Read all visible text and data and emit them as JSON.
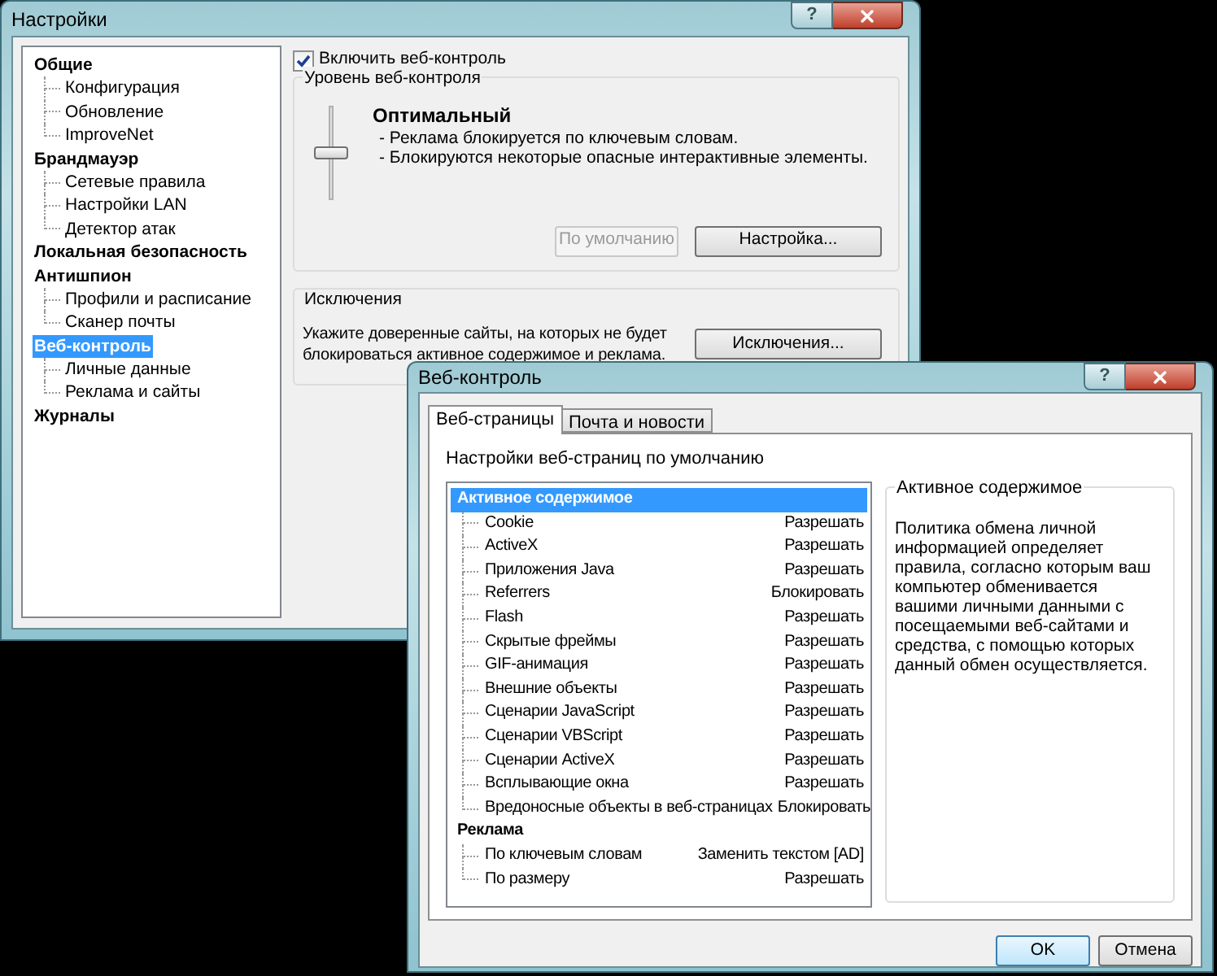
{
  "main_window": {
    "title": "Настройки",
    "help": "?",
    "nav": [
      {
        "label": "Общие",
        "selected": false,
        "children": [
          {
            "label": "Конфигурация",
            "selected": false
          },
          {
            "label": "Обновление",
            "selected": false
          },
          {
            "label": "ImproveNet",
            "selected": false
          }
        ]
      },
      {
        "label": "Брандмауэр",
        "selected": false,
        "children": [
          {
            "label": "Сетевые правила",
            "selected": false
          },
          {
            "label": "Настройки LAN",
            "selected": false
          },
          {
            "label": "Детектор атак",
            "selected": false
          }
        ]
      },
      {
        "label": "Локальная безопасность",
        "selected": false
      },
      {
        "label": "Антишпион",
        "selected": false,
        "children": [
          {
            "label": "Профили и расписание",
            "selected": false
          },
          {
            "label": "Сканер почты",
            "selected": false
          }
        ]
      },
      {
        "label": "Веб-контроль",
        "selected": true,
        "children": [
          {
            "label": "Личные данные",
            "selected": false
          },
          {
            "label": "Реклама и сайты",
            "selected": false
          }
        ]
      },
      {
        "label": "Журналы",
        "selected": false
      }
    ],
    "enable_checkbox": {
      "label": "Включить веб-контроль",
      "checked": true
    },
    "level_group": {
      "title": "Уровень веб-контроля",
      "level": 0.5,
      "level_name": "Оптимальный",
      "details": [
        "- Реклама блокируется по ключевым словам.",
        "- Блокируются некоторые опасные интерактивные элементы."
      ],
      "buttons": [
        {
          "label": "По умолчанию",
          "disabled": true
        },
        {
          "label": "Настройка...",
          "disabled": false
        }
      ]
    },
    "exceptions_group": {
      "title": "Исключения",
      "text": "Укажите доверенные сайты, на которых не будет блокироваться активное содержимое и реклама.",
      "button": "Исключения..."
    }
  },
  "dialog": {
    "title": "Веб-контроль",
    "help": "?",
    "tabs": [
      {
        "label": "Веб-страницы",
        "selected": true
      },
      {
        "label": "Почта и новости",
        "selected": false
      }
    ],
    "list_caption": "Настройки веб-страниц по умолчанию",
    "settings": [
      {
        "label": "Активное содержимое",
        "selected": true,
        "children": [
          {
            "label": "Cookie",
            "value": "Разрешать",
            "selected": false
          },
          {
            "label": "ActiveX",
            "value": "Разрешать",
            "selected": false
          },
          {
            "label": "Приложения Java",
            "value": "Разрешать",
            "selected": false
          },
          {
            "label": "Referrers",
            "value": "Блокировать",
            "selected": false
          },
          {
            "label": "Flash",
            "value": "Разрешать",
            "selected": false
          },
          {
            "label": "Скрытые фреймы",
            "value": "Разрешать",
            "selected": false
          },
          {
            "label": "GIF-анимация",
            "value": "Разрешать",
            "selected": false
          },
          {
            "label": "Внешние объекты",
            "value": "Разрешать",
            "selected": false
          },
          {
            "label": "Сценарии JavaScript",
            "value": "Разрешать",
            "selected": false
          },
          {
            "label": "Сценарии VBScript",
            "value": "Разрешать",
            "selected": false
          },
          {
            "label": "Сценарии ActiveX",
            "value": "Разрешать",
            "selected": false
          },
          {
            "label": "Всплывающие окна",
            "value": "Разрешать",
            "selected": false
          },
          {
            "label": "Вредоносные объекты в веб-страницах",
            "value": "Блокировать",
            "selected": false
          }
        ]
      },
      {
        "label": "Реклама",
        "selected": false,
        "children": [
          {
            "label": "По ключевым словам",
            "value": "Заменить текстом [AD]",
            "selected": false
          },
          {
            "label": "По размеру",
            "value": "Разрешать",
            "selected": false
          }
        ]
      }
    ],
    "info": {
      "title": "Активное содержимое",
      "text": "Политика обмена личной информацией определяет правила, согласно которым ваш компьютер обменивается вашими личными данными с посещаемыми веб-сайтами и средства, с помощью которых данный обмен осуществляется."
    },
    "buttons": [
      {
        "label": "OK",
        "default": true
      },
      {
        "label": "Отмена",
        "default": false
      }
    ]
  }
}
